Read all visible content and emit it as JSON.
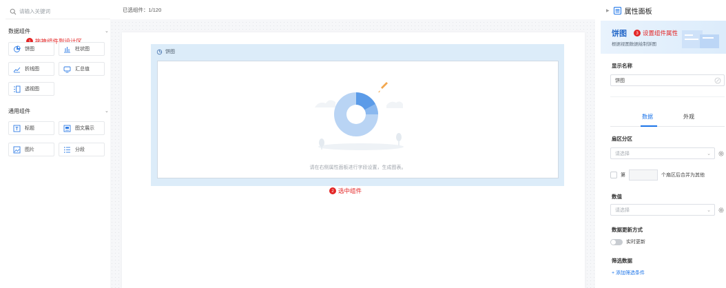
{
  "search": {
    "placeholder": "请输入关键词"
  },
  "sections": {
    "data": {
      "title": "数据组件",
      "items": [
        {
          "label": "饼图",
          "icon": "pie-chart-icon"
        },
        {
          "label": "柱状图",
          "icon": "bar-chart-icon"
        },
        {
          "label": "折线图",
          "icon": "line-chart-icon"
        },
        {
          "label": "汇总值",
          "icon": "summary-icon"
        },
        {
          "label": "透视图",
          "icon": "pivot-icon"
        }
      ]
    },
    "general": {
      "title": "通用组件",
      "items": [
        {
          "label": "标题",
          "icon": "title-icon"
        },
        {
          "label": "图文展示",
          "icon": "image-text-icon"
        },
        {
          "label": "图片",
          "icon": "image-icon"
        },
        {
          "label": "分段",
          "icon": "section-icon"
        }
      ]
    }
  },
  "steps": {
    "one": {
      "num": "1",
      "text": "拖拽组件到设计区"
    },
    "two": {
      "num": "2",
      "text": "选中组件"
    },
    "three": {
      "num": "3",
      "text": "设置组件属性"
    }
  },
  "center": {
    "selected_label": "已选组件：1/120",
    "widget_title": "饼图",
    "empty_hint": "请在右侧属性面板进行字段设置，生成图表。"
  },
  "panel": {
    "title": "属性面板",
    "banner_title": "饼图",
    "banner_sub": "根据视图数据绘制饼图",
    "display_name_label": "显示名称",
    "display_name_value": "饼图",
    "tabs": [
      "数据",
      "外观"
    ],
    "sector_label": "扇区分区",
    "sector_placeholder": "请选择",
    "merge_prefix": "第",
    "merge_suffix": "个扇区后合并为其他",
    "value_label": "数值",
    "value_placeholder": "请选择",
    "update_label": "数据更新方式",
    "update_toggle": "实时更新",
    "filter_label": "筛选数据",
    "filter_add": "+ 添加筛选条件"
  },
  "colors": {
    "accent": "#1a73e8",
    "step_red": "#e32424",
    "widget_bg": "#dcecf9"
  }
}
